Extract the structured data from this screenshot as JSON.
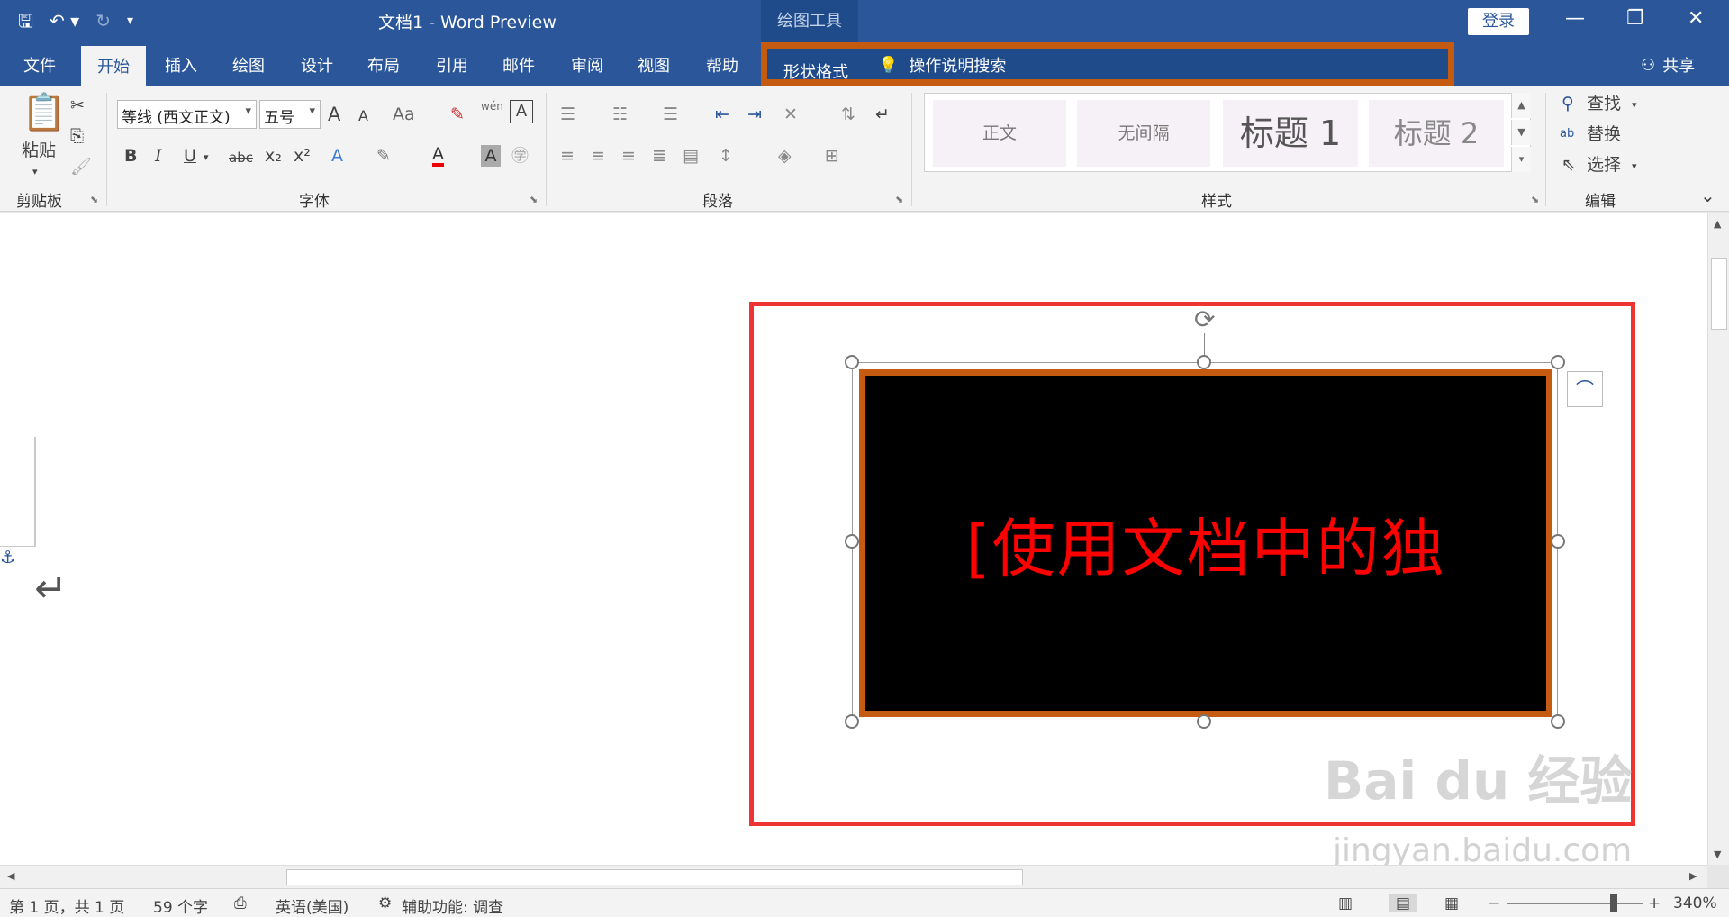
{
  "titlebar": {
    "title": "文档1  -  Word Preview",
    "context_tab_group": "绘图工具",
    "login_label": "登录",
    "minimize_glyph": "—",
    "restore_glyph": "❐",
    "close_glyph": "✕"
  },
  "tabs": {
    "file": "文件",
    "home": "开始",
    "insert": "插入",
    "draw": "绘图",
    "design": "设计",
    "layout": "布局",
    "references": "引用",
    "mailings": "邮件",
    "review": "审阅",
    "view": "视图",
    "help": "帮助",
    "shape_format": "形状格式",
    "tell_me": "操作说明搜索",
    "share": "共享"
  },
  "ribbon": {
    "clipboard": {
      "paste_label": "粘贴",
      "group_label": "剪贴板"
    },
    "font": {
      "font_name": "等线 (西文正文)",
      "font_size": "五号",
      "group_label": "字体",
      "bold": "B",
      "italic": "I",
      "underline": "U",
      "strikethrough": "abc",
      "subscript": "x₂",
      "superscript": "x²",
      "grow": "A",
      "shrink": "A",
      "change_case": "Aa",
      "phonetic": "wén",
      "font_color": "A",
      "char_shading": "A"
    },
    "paragraph": {
      "group_label": "段落"
    },
    "styles": {
      "group_label": "样式",
      "items": [
        "正文",
        "无间隔",
        "标题 1",
        "标题 2"
      ]
    },
    "editing": {
      "group_label": "编辑",
      "find": "查找",
      "replace": "替换",
      "select": "选择"
    }
  },
  "document": {
    "shape_text": "[使用文档中的独"
  },
  "watermark": {
    "logo_text": "Bai du 经验",
    "url": "jingyan.baidu.com"
  },
  "status": {
    "page": "第 1 页，共 1 页",
    "words": "59 个字",
    "language": "英语(美国)",
    "accessibility": "辅助功能: 调查",
    "zoom": "340%"
  },
  "colors": {
    "brand": "#2b579a",
    "shape_fill": "#000000",
    "shape_outline": "#c55a11",
    "shape_text": "#ff0000",
    "annotation": "#ee3333"
  }
}
